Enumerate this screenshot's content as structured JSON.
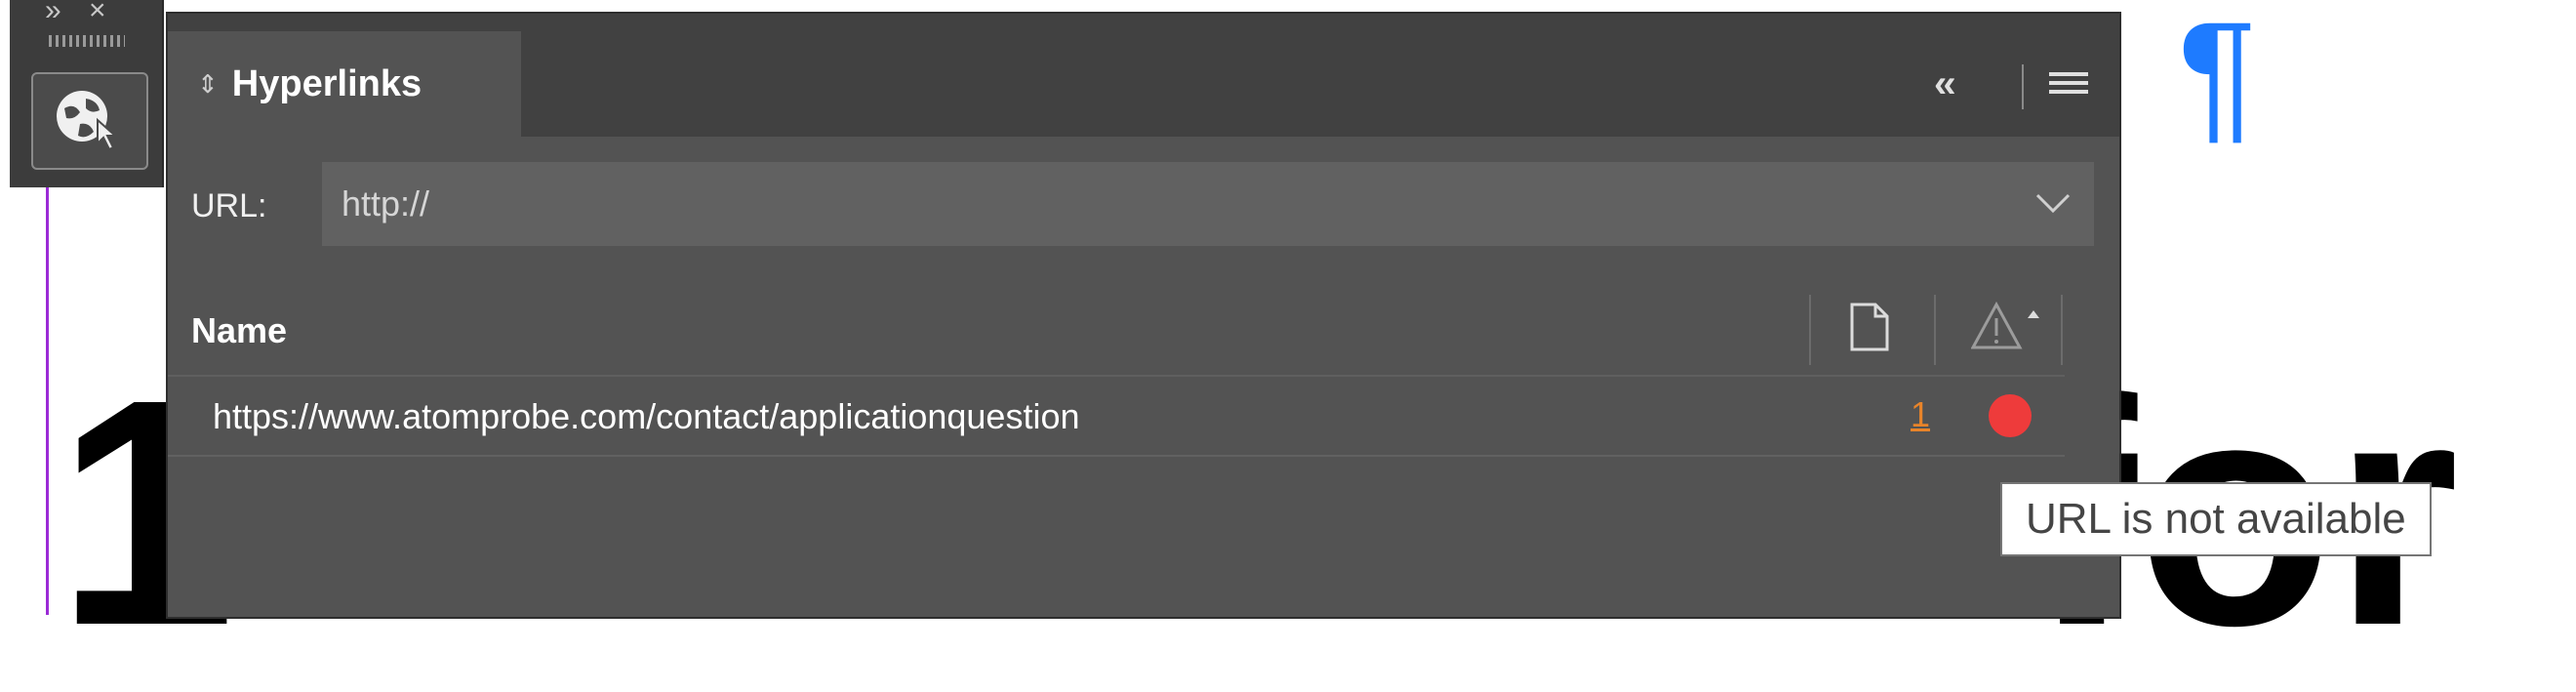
{
  "panel": {
    "title": "Hyperlinks"
  },
  "url": {
    "label": "URL:",
    "value": "http://"
  },
  "list": {
    "column_name": "Name",
    "rows": [
      {
        "url": "https://www.atomprobe.com/contact/applicationquestion",
        "page": "1",
        "status": "error"
      }
    ]
  },
  "tooltip": "URL is not available",
  "document": {
    "big_digit": "1",
    "big_text": "for",
    "pilcrow": "¶"
  },
  "colors": {
    "panel_bg": "#535353",
    "header_bg": "#414141",
    "status_error": "#ee3b3b",
    "page_link": "#e8842a",
    "pilcrow": "#1e7bff",
    "margin_guide": "#9b2bd6"
  },
  "icons": {
    "dock": "hyperlinks-globe-icon",
    "collapse": "double-chevron-left-icon",
    "menu": "hamburger-menu-icon",
    "page": "page-icon",
    "status": "warning-sort-icon",
    "dropdown": "chevron-down-icon"
  }
}
